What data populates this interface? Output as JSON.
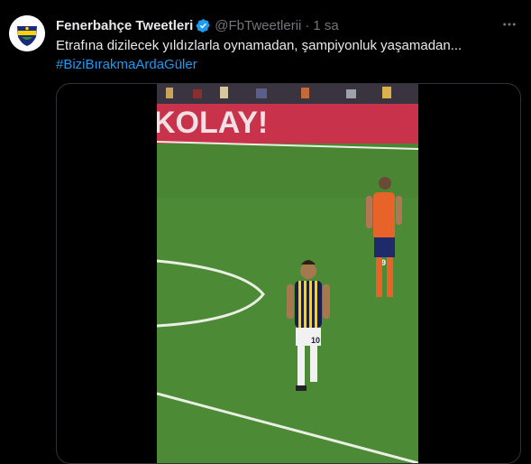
{
  "tweet": {
    "author_name": "Fenerbahçe Tweetleri",
    "handle": "@FbTweetlerii",
    "separator": "·",
    "time": "1 sa",
    "text": "Etrafına dizilecek yıldızlarla oynamadan, şampiyonluk yaşamadan...",
    "hashtag": "#BiziBırakmaArdaGüler",
    "verified": true
  },
  "media": {
    "banner_text": "KOLAY!",
    "player_front_number": "10",
    "player_back_number": "59"
  },
  "icons": {
    "verified": "verified-badge-icon",
    "more": "more-options-icon",
    "avatar": "fenerbahce-logo-avatar"
  },
  "colors": {
    "background": "#000000",
    "text": "#e7e9ea",
    "muted": "#71767b",
    "link": "#1d9bf0",
    "verified": "#1d9bf0",
    "pitch": "#4d8a35",
    "banner": "#c8324a"
  }
}
